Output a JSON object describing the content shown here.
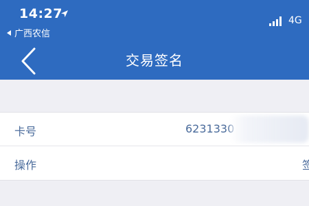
{
  "status_bar": {
    "time": "14:27",
    "back_app_label": "广西农信",
    "network": "4G",
    "location_icon": "location-arrow-icon",
    "signal_icon": "signal-bars-icon"
  },
  "nav": {
    "title": "交易签名",
    "back_icon": "chevron-left-icon"
  },
  "details": {
    "card_number_label": "卡号",
    "card_number_value": "6231330",
    "operation_label": "操作",
    "operation_value": "签"
  },
  "colors": {
    "header": "#2e6bc0",
    "background": "#efeff4",
    "text": "#4a6b9b"
  }
}
